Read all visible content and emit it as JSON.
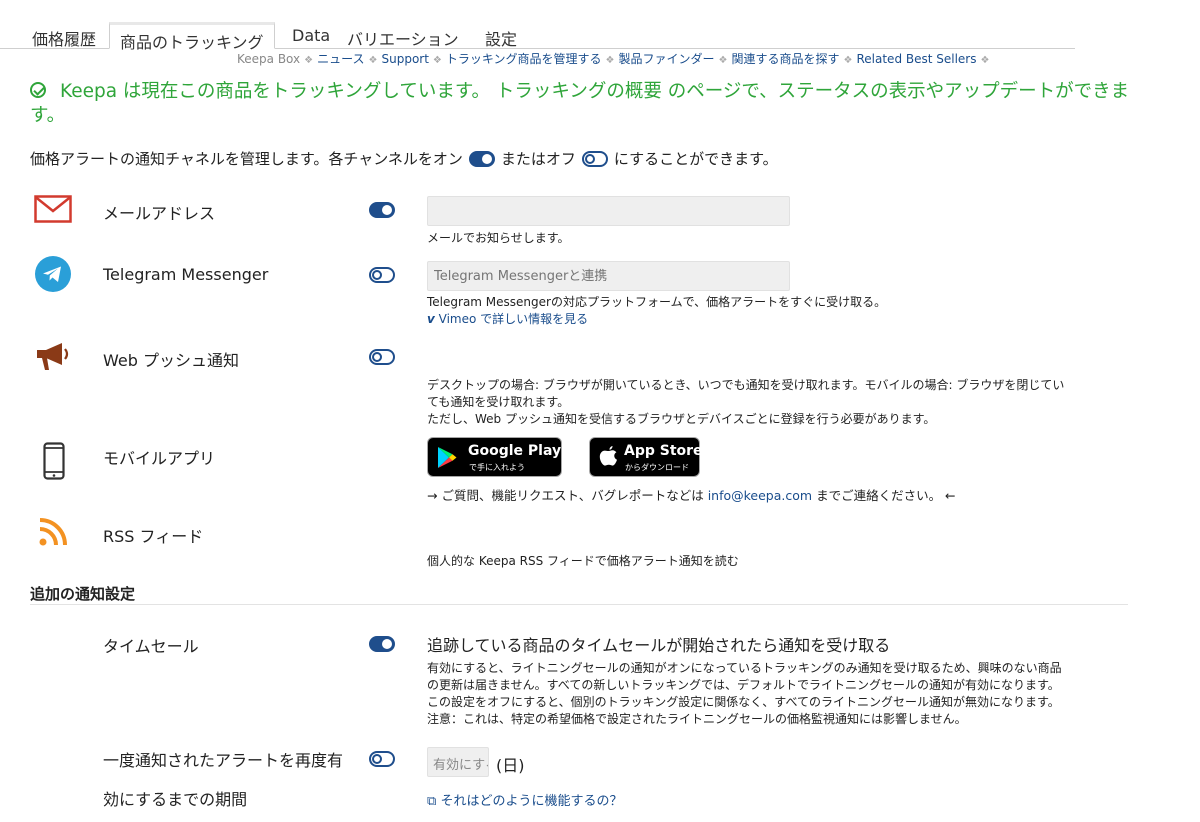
{
  "tabs": [
    {
      "label": "価格履歴"
    },
    {
      "label": "商品のトラッキング"
    },
    {
      "label": "Data"
    },
    {
      "label": "バリエーション"
    },
    {
      "label": "設定"
    }
  ],
  "subnav": {
    "brand": "Keepa Box",
    "links": [
      "ニュース",
      "Support",
      "トラッキング商品を管理する",
      "製品ファインダー",
      "関連する商品を探す",
      "Related Best Sellers"
    ]
  },
  "status": {
    "part1": "Keepa は現在この商品をトラッキングしています。",
    "link": "トラッキングの概要",
    "part2": " のページで、ステータスの表示やアップデートができます。"
  },
  "intro": {
    "part1": "価格アラートの通知チャネルを管理します。各チャンネルをオン",
    "part2": "またはオフ",
    "part3": "にすることができます。"
  },
  "channels": {
    "email": {
      "label": "メールアドレス",
      "value": "",
      "note": "メールでお知らせします。",
      "enabled": true
    },
    "telegram": {
      "label": "Telegram Messenger",
      "placeholder": "Telegram Messengerと連携",
      "note": "Telegram Messengerの対応プラットフォームで、価格アラートをすぐに受け取る。",
      "link": "Vimeo で詳しい情報を見る",
      "enabled": false
    },
    "webpush": {
      "label": "Web プッシュ通知",
      "note1": "デスクトップの場合: ブラウザが開いているとき、いつでも通知を受け取れます。モバイルの場合: ブラウザを閉じてい",
      "note2": "ても通知を受け取れます。",
      "note3": "ただし、Web プッシュ通知を受信するブラウザとデバイスごとに登録を行う必要があります。",
      "enabled": false
    },
    "mobile": {
      "label": "モバイルアプリ",
      "google_play_title": "Google Play",
      "google_play_sub": "で手に入れよう",
      "app_store_title": "App Store",
      "app_store_sub": "からダウンロード",
      "contact_pre": "→ ご質問、機能リクエスト、バグレポートなどは",
      "contact_email": "info@keepa.com",
      "contact_post": "までご連絡ください。 ←"
    },
    "rss": {
      "label": "RSS フィード",
      "note": "個人的な Keepa RSS フィードで価格アラート通知を読む"
    }
  },
  "additional": {
    "title": "追加の通知設定",
    "timesale": {
      "label": "タイムセール",
      "enabled": true,
      "headline": "追跡している商品のタイムセールが開始されたら通知を受け取る",
      "para": [
        "有効にすると、ライトニングセールの通知がオンになっているトラッキングのみ通知を受け取るため、興味のない商品",
        "の更新は届きません。すべての新しいトラッキングでは、デフォルトでライトニングセールの通知が有効になります。",
        "この設定をオフにすると、個別のトラッキング設定に関係なく、すべてのライトニングセール通知が無効になります。",
        "注意：これは、特定の希望価格で設定されたライトニングセールの価格監視通知には影響しません。"
      ]
    },
    "rearm": {
      "label_line1": "一度通知されたアラートを再度有",
      "label_line2": "効にするまでの期間",
      "enabled": false,
      "input_placeholder": "有効にする",
      "unit": "(日)",
      "link": "それはどのように機能するの？"
    }
  },
  "colors": {
    "accent": "#1f4e8c",
    "status_green": "#2fa53a",
    "link": "#1a4d8c",
    "email_icon": "#d23a2e",
    "telegram_icon": "#2a9fd8",
    "webpush_icon": "#8a3a17",
    "rss_icon": "#f39222"
  }
}
